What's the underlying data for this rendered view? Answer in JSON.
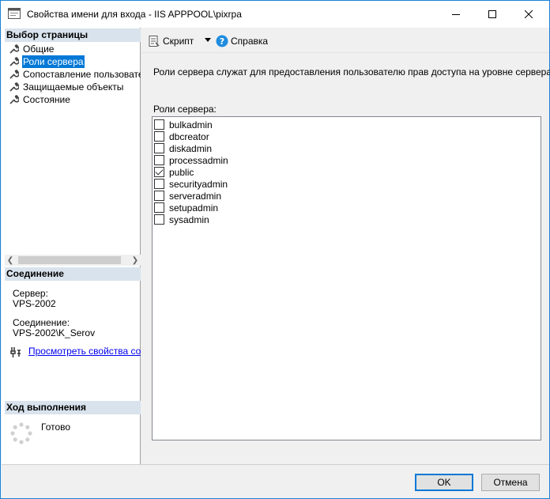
{
  "window": {
    "title": "Свойства имени для входа - IIS APPPOOL\\pixrpa"
  },
  "left_pane": {
    "select_page_header": "Выбор страницы",
    "nav_items": [
      {
        "label": "Общие",
        "icon": "wrench-icon"
      },
      {
        "label": "Роли сервера",
        "icon": "wrench-icon",
        "selected": true
      },
      {
        "label": "Сопоставление пользователей",
        "icon": "wrench-icon"
      },
      {
        "label": "Защищаемые объекты",
        "icon": "wrench-icon"
      },
      {
        "label": "Состояние",
        "icon": "wrench-icon"
      }
    ],
    "connection_header": "Соединение",
    "server_label": "Сервер:",
    "server_value": "VPS-2002",
    "connection_label": "Соединение:",
    "connection_value": "VPS-2002\\K_Serov",
    "view_props_link": "Просмотреть свойства соединения",
    "progress_header": "Ход выполнения",
    "progress_status": "Готово"
  },
  "toolbar": {
    "script_label": "Скрипт",
    "help_label": "Справка"
  },
  "main": {
    "description": "Роли сервера служат для предоставления пользователю прав доступа на уровне сервера.",
    "roles_label": "Роли сервера:",
    "roles": [
      {
        "name": "bulkadmin",
        "checked": false
      },
      {
        "name": "dbcreator",
        "checked": false
      },
      {
        "name": "diskadmin",
        "checked": false
      },
      {
        "name": "processadmin",
        "checked": false
      },
      {
        "name": "public",
        "checked": true
      },
      {
        "name": "securityadmin",
        "checked": false
      },
      {
        "name": "serveradmin",
        "checked": false
      },
      {
        "name": "setupadmin",
        "checked": false
      },
      {
        "name": "sysadmin",
        "checked": false
      }
    ]
  },
  "buttons": {
    "ok": "OK",
    "cancel": "Отмена"
  },
  "colors": {
    "selection": "#0078d7",
    "section_header_bg": "#d9e3ed",
    "link": "#0000ee"
  }
}
